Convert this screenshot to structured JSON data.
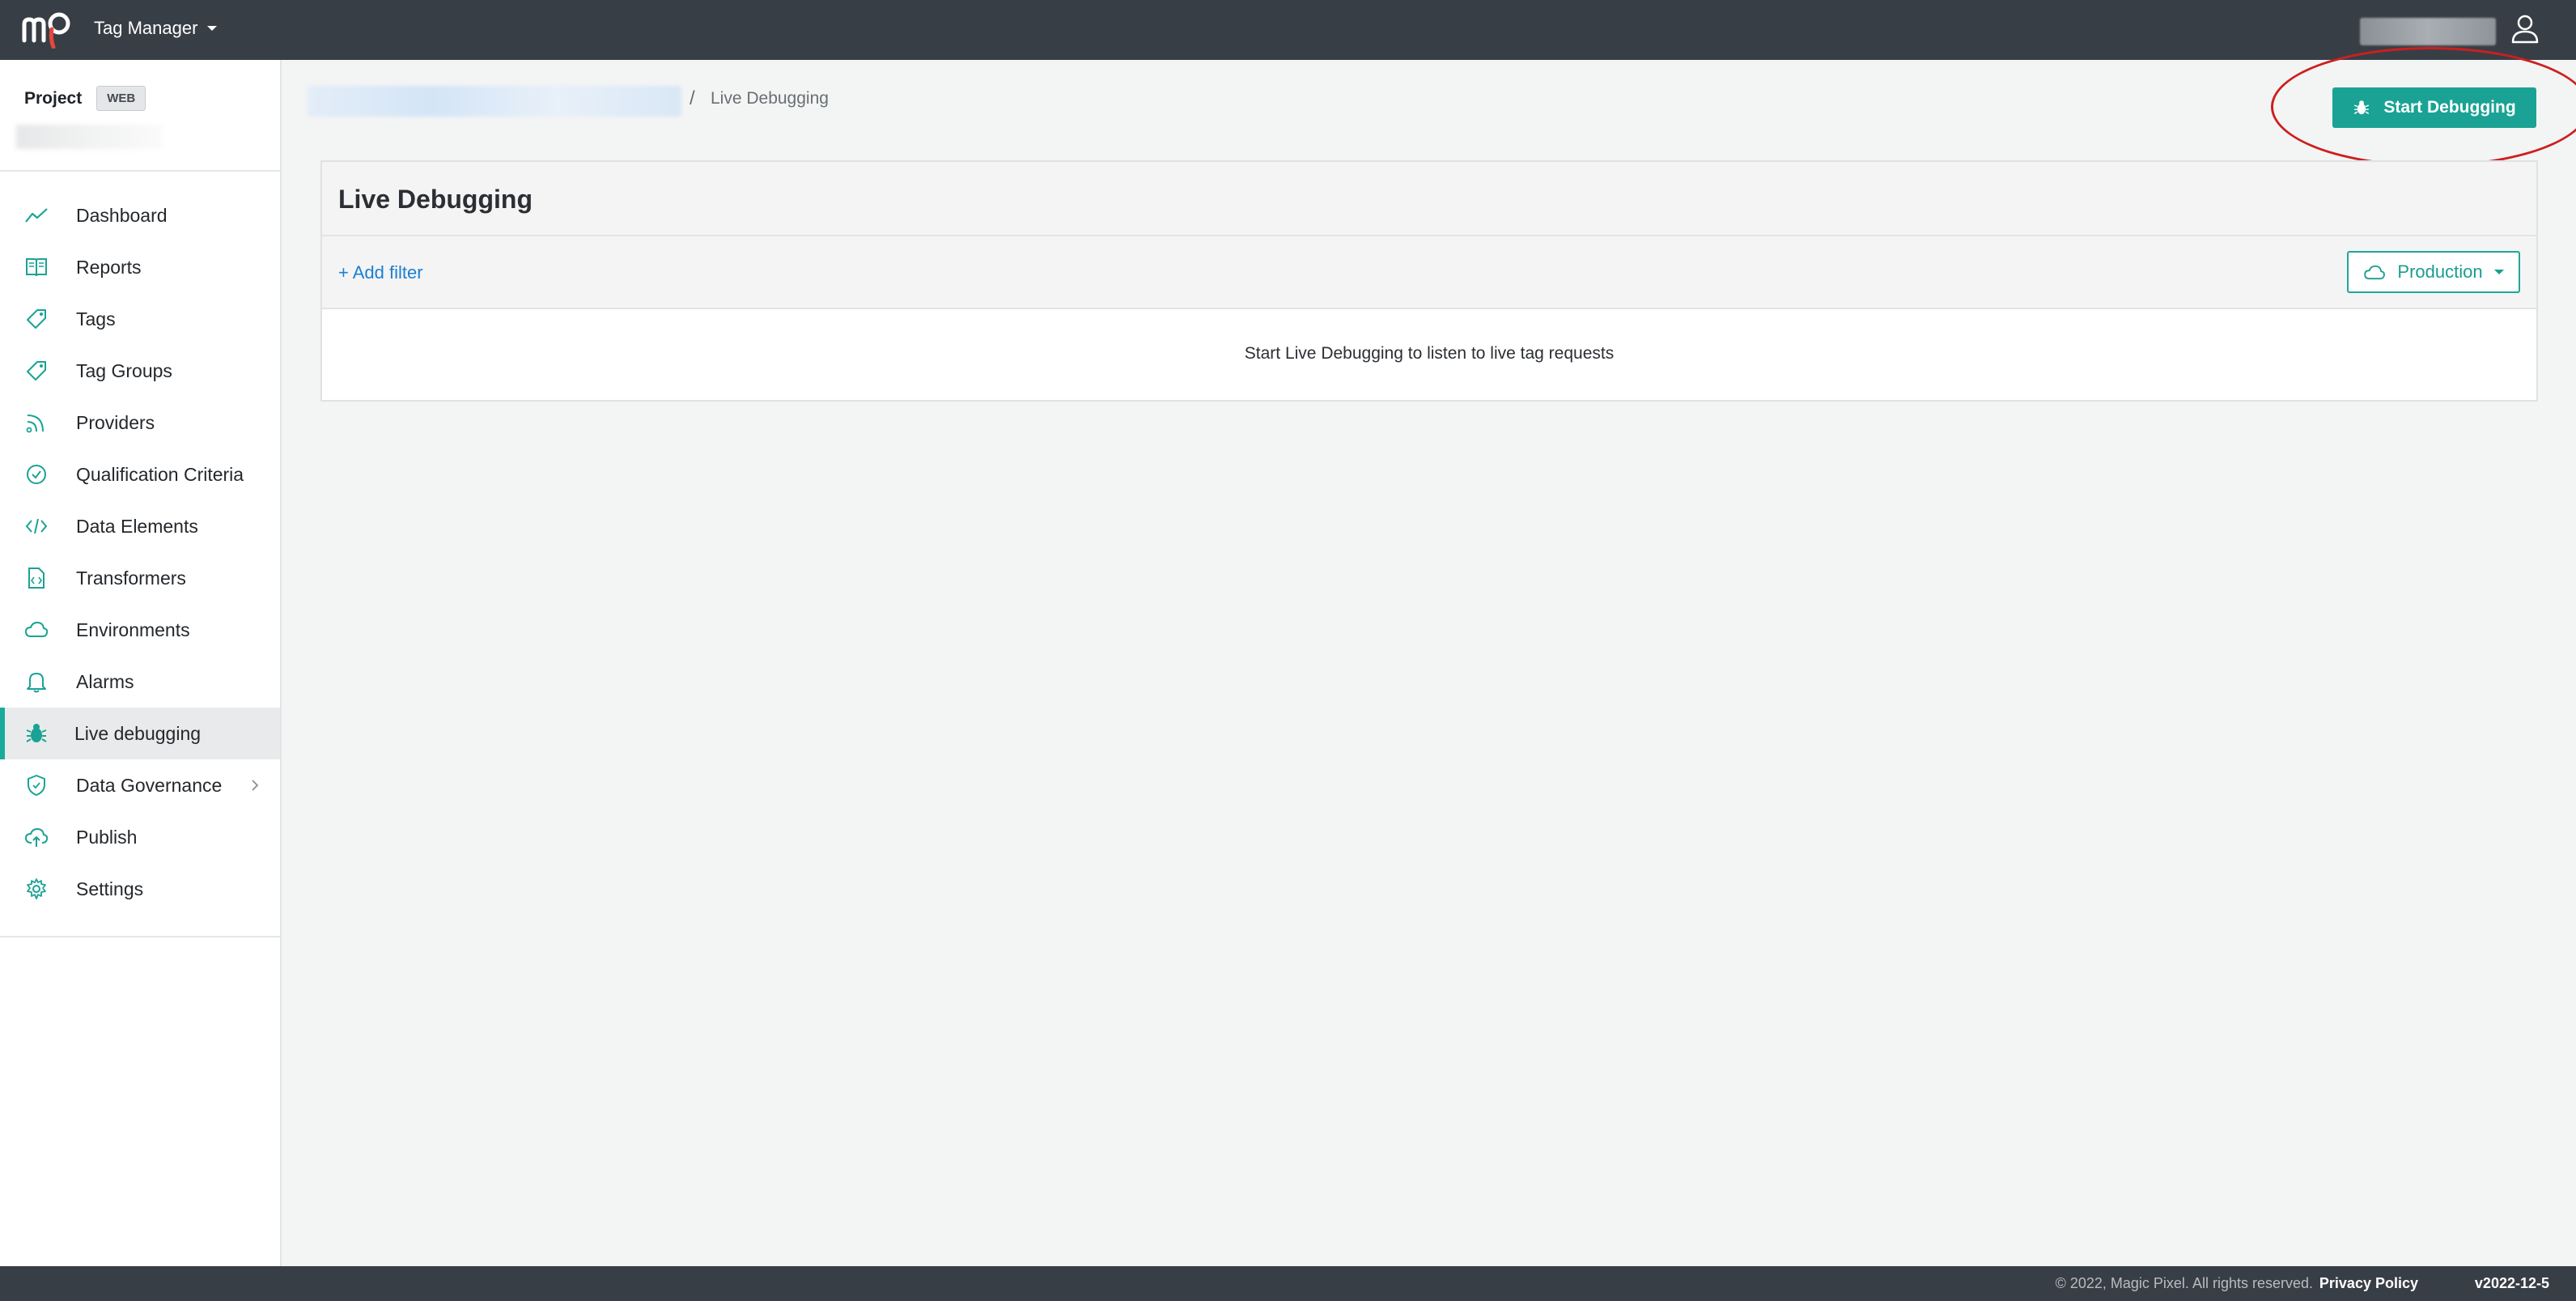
{
  "topbar": {
    "app_name": "Tag Manager"
  },
  "sidebar": {
    "project_label": "Project",
    "project_type": "WEB",
    "items": [
      {
        "label": "Dashboard",
        "icon": "chart-line-icon"
      },
      {
        "label": "Reports",
        "icon": "book-icon"
      },
      {
        "label": "Tags",
        "icon": "tag-icon"
      },
      {
        "label": "Tag Groups",
        "icon": "tag-icon"
      },
      {
        "label": "Providers",
        "icon": "rss-icon"
      },
      {
        "label": "Qualification Criteria",
        "icon": "check-circle-icon"
      },
      {
        "label": "Data Elements",
        "icon": "code-icon"
      },
      {
        "label": "Transformers",
        "icon": "file-code-icon"
      },
      {
        "label": "Environments",
        "icon": "cloud-icon"
      },
      {
        "label": "Alarms",
        "icon": "bell-icon"
      },
      {
        "label": "Live debugging",
        "icon": "bug-icon",
        "active": true
      },
      {
        "label": "Data Governance",
        "icon": "shield-icon",
        "has_submenu": true
      },
      {
        "label": "Publish",
        "icon": "cloud-upload-icon"
      },
      {
        "label": "Settings",
        "icon": "gear-icon"
      }
    ]
  },
  "breadcrumb": {
    "separator": "/",
    "current": "Live Debugging"
  },
  "actions": {
    "start_debugging": "Start Debugging"
  },
  "panel": {
    "title": "Live Debugging",
    "add_filter": "+ Add filter",
    "environment": "Production",
    "empty_message": "Start Live Debugging to listen to live tag requests"
  },
  "footer": {
    "copyright": "© 2022, Magic Pixel. All rights reserved.",
    "privacy": "Privacy Policy",
    "version": "v2022-12-5"
  },
  "colors": {
    "topbar": "#383e46",
    "accent": "#1aa394",
    "link": "#1b7fd2",
    "annotation": "#cc1f1f"
  }
}
